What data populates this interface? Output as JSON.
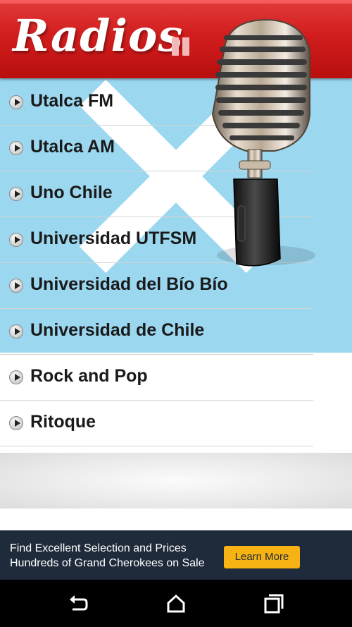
{
  "header": {
    "title": "Radios",
    "pause_icon": "pause-icon"
  },
  "stations": [
    {
      "label": "Utalca FM"
    },
    {
      "label": "Utalca AM"
    },
    {
      "label": "Uno Chile"
    },
    {
      "label": "Universidad UTFSM"
    },
    {
      "label": "Universidad del Bío Bío"
    },
    {
      "label": "Universidad de Chile"
    },
    {
      "label": "Rock and Pop"
    },
    {
      "label": "Ritoque"
    }
  ],
  "ad": {
    "line1": "Find Excellent Selection and Prices",
    "line2": "Hundreds of Grand Cherokees on Sale",
    "button": "Learn More"
  },
  "navbar": {
    "back": "back-icon",
    "home": "home-icon",
    "recents": "recents-icon"
  },
  "colors": {
    "header_red": "#d21d1d",
    "ad_bg": "#1f2b3b",
    "ad_button": "#f6b313"
  }
}
